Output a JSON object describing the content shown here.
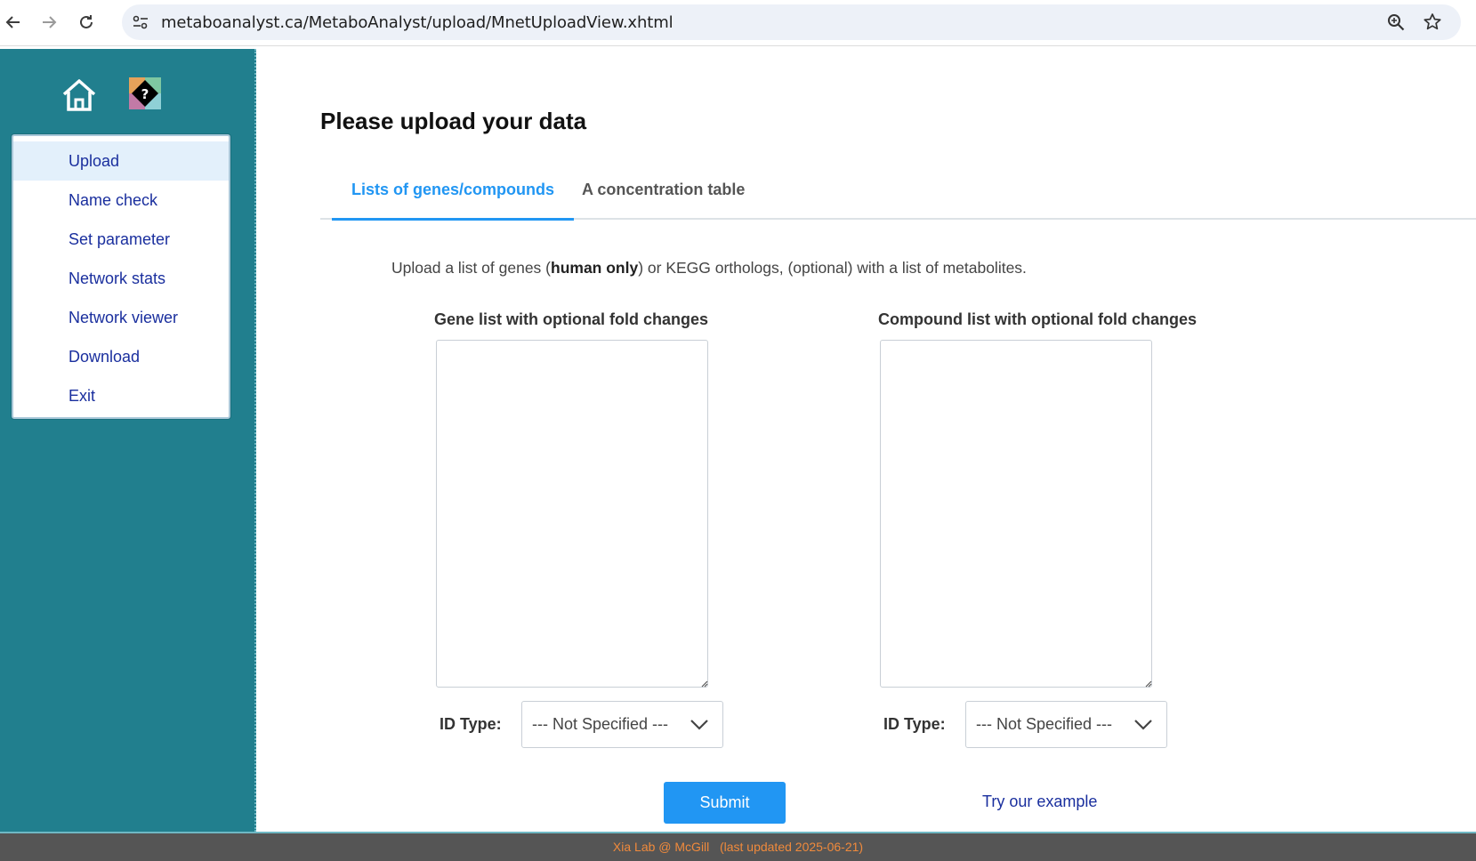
{
  "browser": {
    "url": "metaboanalyst.ca/MetaboAnalyst/upload/MnetUploadView.xhtml"
  },
  "sidebar": {
    "items": [
      {
        "label": "Upload",
        "active": true
      },
      {
        "label": "Name check"
      },
      {
        "label": "Set parameter"
      },
      {
        "label": "Network stats"
      },
      {
        "label": "Network viewer"
      },
      {
        "label": "Download"
      },
      {
        "label": "Exit"
      }
    ]
  },
  "main": {
    "title": "Please upload your data",
    "tabs": [
      {
        "label": "Lists of genes/compounds",
        "active": true
      },
      {
        "label": "A concentration table"
      }
    ],
    "description": {
      "before": "Upload a list of genes (",
      "bold": "human only",
      "after": ") or KEGG orthologs, (optional) with a list of metabolites."
    },
    "gene": {
      "label": "Gene list with optional fold changes",
      "value": "",
      "id_label": "ID Type:",
      "id_value": "--- Not Specified ---"
    },
    "compound": {
      "label": "Compound list with optional fold changes",
      "value": "",
      "id_label": "ID Type:",
      "id_value": "--- Not Specified ---"
    },
    "submit_label": "Submit",
    "example_label": "Try our example"
  },
  "footer": {
    "text": "Xia Lab @ McGill   (last updated 2025-06-21)"
  },
  "colors": {
    "sidebar": "#217f8e",
    "accent": "#2196f3",
    "link": "#1a2f9e",
    "footer_bg": "#555555",
    "footer_text": "#f08a3c"
  }
}
